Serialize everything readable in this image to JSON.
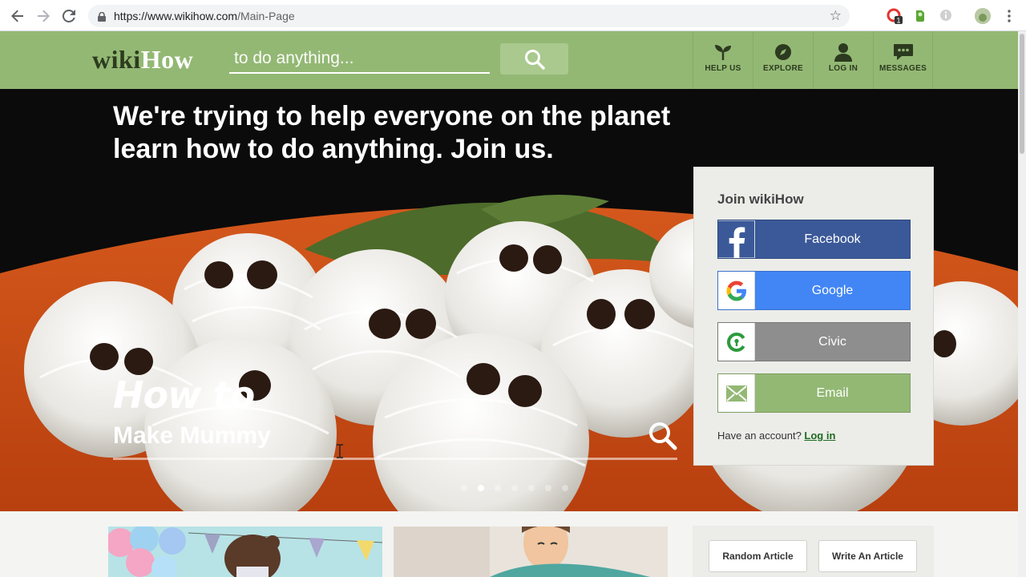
{
  "browser": {
    "url_host": "https://www.wikihow.com",
    "url_path": "/Main-Page",
    "ext_badge": "1"
  },
  "header": {
    "logo_wiki": "wiki",
    "logo_how": "How",
    "search_placeholder": "to do anything...",
    "nav": [
      {
        "label": "HELP US",
        "icon": "sprout-icon"
      },
      {
        "label": "EXPLORE",
        "icon": "compass-icon"
      },
      {
        "label": "LOG IN",
        "icon": "user-icon"
      },
      {
        "label": "MESSAGES",
        "icon": "chat-bubble-icon"
      }
    ]
  },
  "hero": {
    "headline": "We're trying to help everyone on the planet learn how to do anything. Join us.",
    "howto": "How to",
    "topic": "Make Mummy",
    "carousel_count": 7,
    "carousel_active": 1
  },
  "join": {
    "title": "Join wikiHow",
    "buttons": {
      "facebook": "Facebook",
      "google": "Google",
      "civic": "Civic",
      "email": "Email"
    },
    "have_account": "Have an account?",
    "login_link": "Log in"
  },
  "lower": {
    "random_article": "Random Article",
    "write_article": "Write An Article"
  },
  "colors": {
    "brand_green": "#93b874",
    "facebook": "#3b5998",
    "google": "#4285f4",
    "civic": "#8e8e8e"
  }
}
